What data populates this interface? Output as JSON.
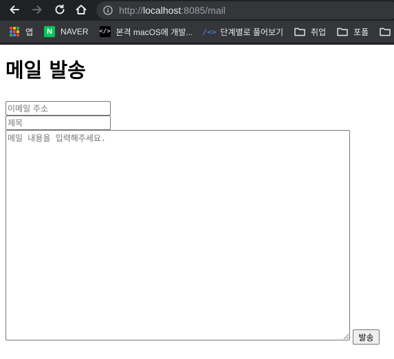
{
  "browser": {
    "url_scheme": "http://",
    "url_host": "localhost",
    "url_rest": ":8085/mail",
    "bookmarks": [
      {
        "label": "앱",
        "icon": "apps-grid-icon"
      },
      {
        "label": "NAVER",
        "icon": "naver-icon"
      },
      {
        "label": "본격 macOS에 개발...",
        "icon": "code-icon"
      },
      {
        "label": "단계별로 풀어보기",
        "icon": "code-bracket-icon"
      },
      {
        "label": "취업",
        "icon": "folder-icon"
      },
      {
        "label": "포폴",
        "icon": "folder-icon"
      },
      {
        "label": "포",
        "icon": "folder-icon"
      }
    ],
    "naver_letter": "N",
    "code_glyph": "</>",
    "code2_glyph": "/<>"
  },
  "page": {
    "title": "메일 발송",
    "email_placeholder": "이메일 주소",
    "subject_placeholder": "제목",
    "body_placeholder": "메일 내용을 입력해주세요.",
    "send_label": "발송"
  }
}
